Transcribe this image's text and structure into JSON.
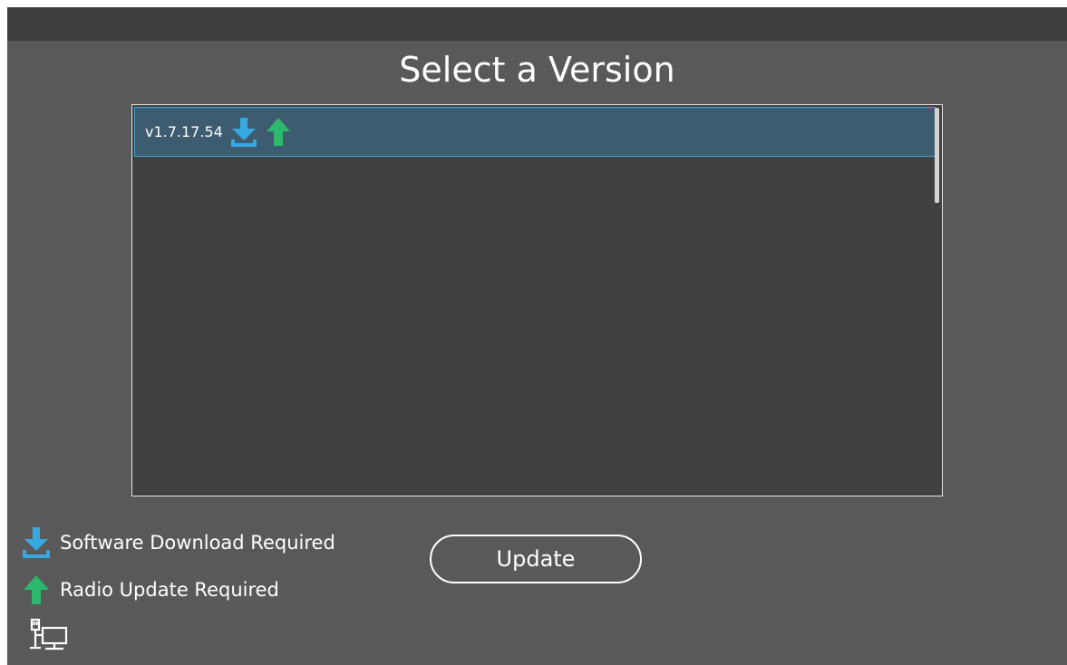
{
  "page": {
    "title": "Select a Version"
  },
  "version_list": {
    "items": [
      {
        "label": "v1.7.17.54",
        "icons": [
          "download-icon",
          "arrow-up-icon"
        ],
        "selected": true
      }
    ]
  },
  "legend": {
    "items": [
      {
        "icon": "download-icon",
        "label": "Software Download Required"
      },
      {
        "icon": "arrow-up-icon",
        "label": "Radio Update Required"
      }
    ]
  },
  "actions": {
    "update_label": "Update"
  },
  "status": {
    "connection_icon": "network-connection-icon"
  },
  "colors": {
    "window_bg": "#595959",
    "title_bar_bg": "#3f3f3f",
    "list_bg": "#404040",
    "selected_row_bg": "#3d5c70",
    "selected_row_border": "#3fa6d8",
    "download_blue": "#38a9e0",
    "update_green": "#2db86d"
  }
}
